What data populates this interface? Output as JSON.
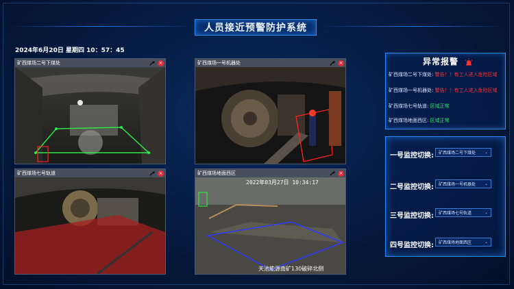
{
  "app": {
    "title": "人员接近预警防护系统",
    "datetime": "2024年6月20日 星期四 10：57：45"
  },
  "cameras": [
    {
      "title": "矿西煤场二号下煤处",
      "close": "×"
    },
    {
      "title": "矿西煤场一号机器处",
      "close": "×"
    },
    {
      "title": "矿西煤场七号轨道",
      "close": "×"
    },
    {
      "title": "矿西煤场地面西区",
      "close": "×",
      "overlay_timestamp": "2022年03月27日 10:34:17",
      "overlay_caption": "天池能源南矿130破碎北侧"
    }
  ],
  "alarm": {
    "title": "异常报警",
    "items": [
      {
        "location": "矿西煤场二号下煤处:",
        "message": "警告！！有工人进入危险区域",
        "status": "warn"
      },
      {
        "location": "矿西煤场一号机器处:",
        "message": "警告！！有工人进入危险区域",
        "status": "warn"
      },
      {
        "location": "矿西煤场七号轨道:",
        "message": "区域正常",
        "status": "ok"
      },
      {
        "location": "矿西煤场地面西区:",
        "message": "区域正常",
        "status": "ok"
      }
    ]
  },
  "switch": {
    "items": [
      {
        "label": "一号监控切换:",
        "value": "矿西煤场二号下煤处"
      },
      {
        "label": "二号监控切换:",
        "value": "矿西煤场一号机器处"
      },
      {
        "label": "三号监控切换:",
        "value": "矿西煤场七号轨道"
      },
      {
        "label": "四号监控切换:",
        "value": "矿西煤场地面西区"
      }
    ]
  },
  "colors": {
    "accent": "#2a8dff",
    "warn": "#ff3333",
    "ok": "#2de86b",
    "close": "#e02a3a"
  },
  "icons": {
    "camera_tool": "wrench-icon",
    "close": "close-icon",
    "alarm": "alarm-bell-icon",
    "select": "chevron-down-icon"
  }
}
